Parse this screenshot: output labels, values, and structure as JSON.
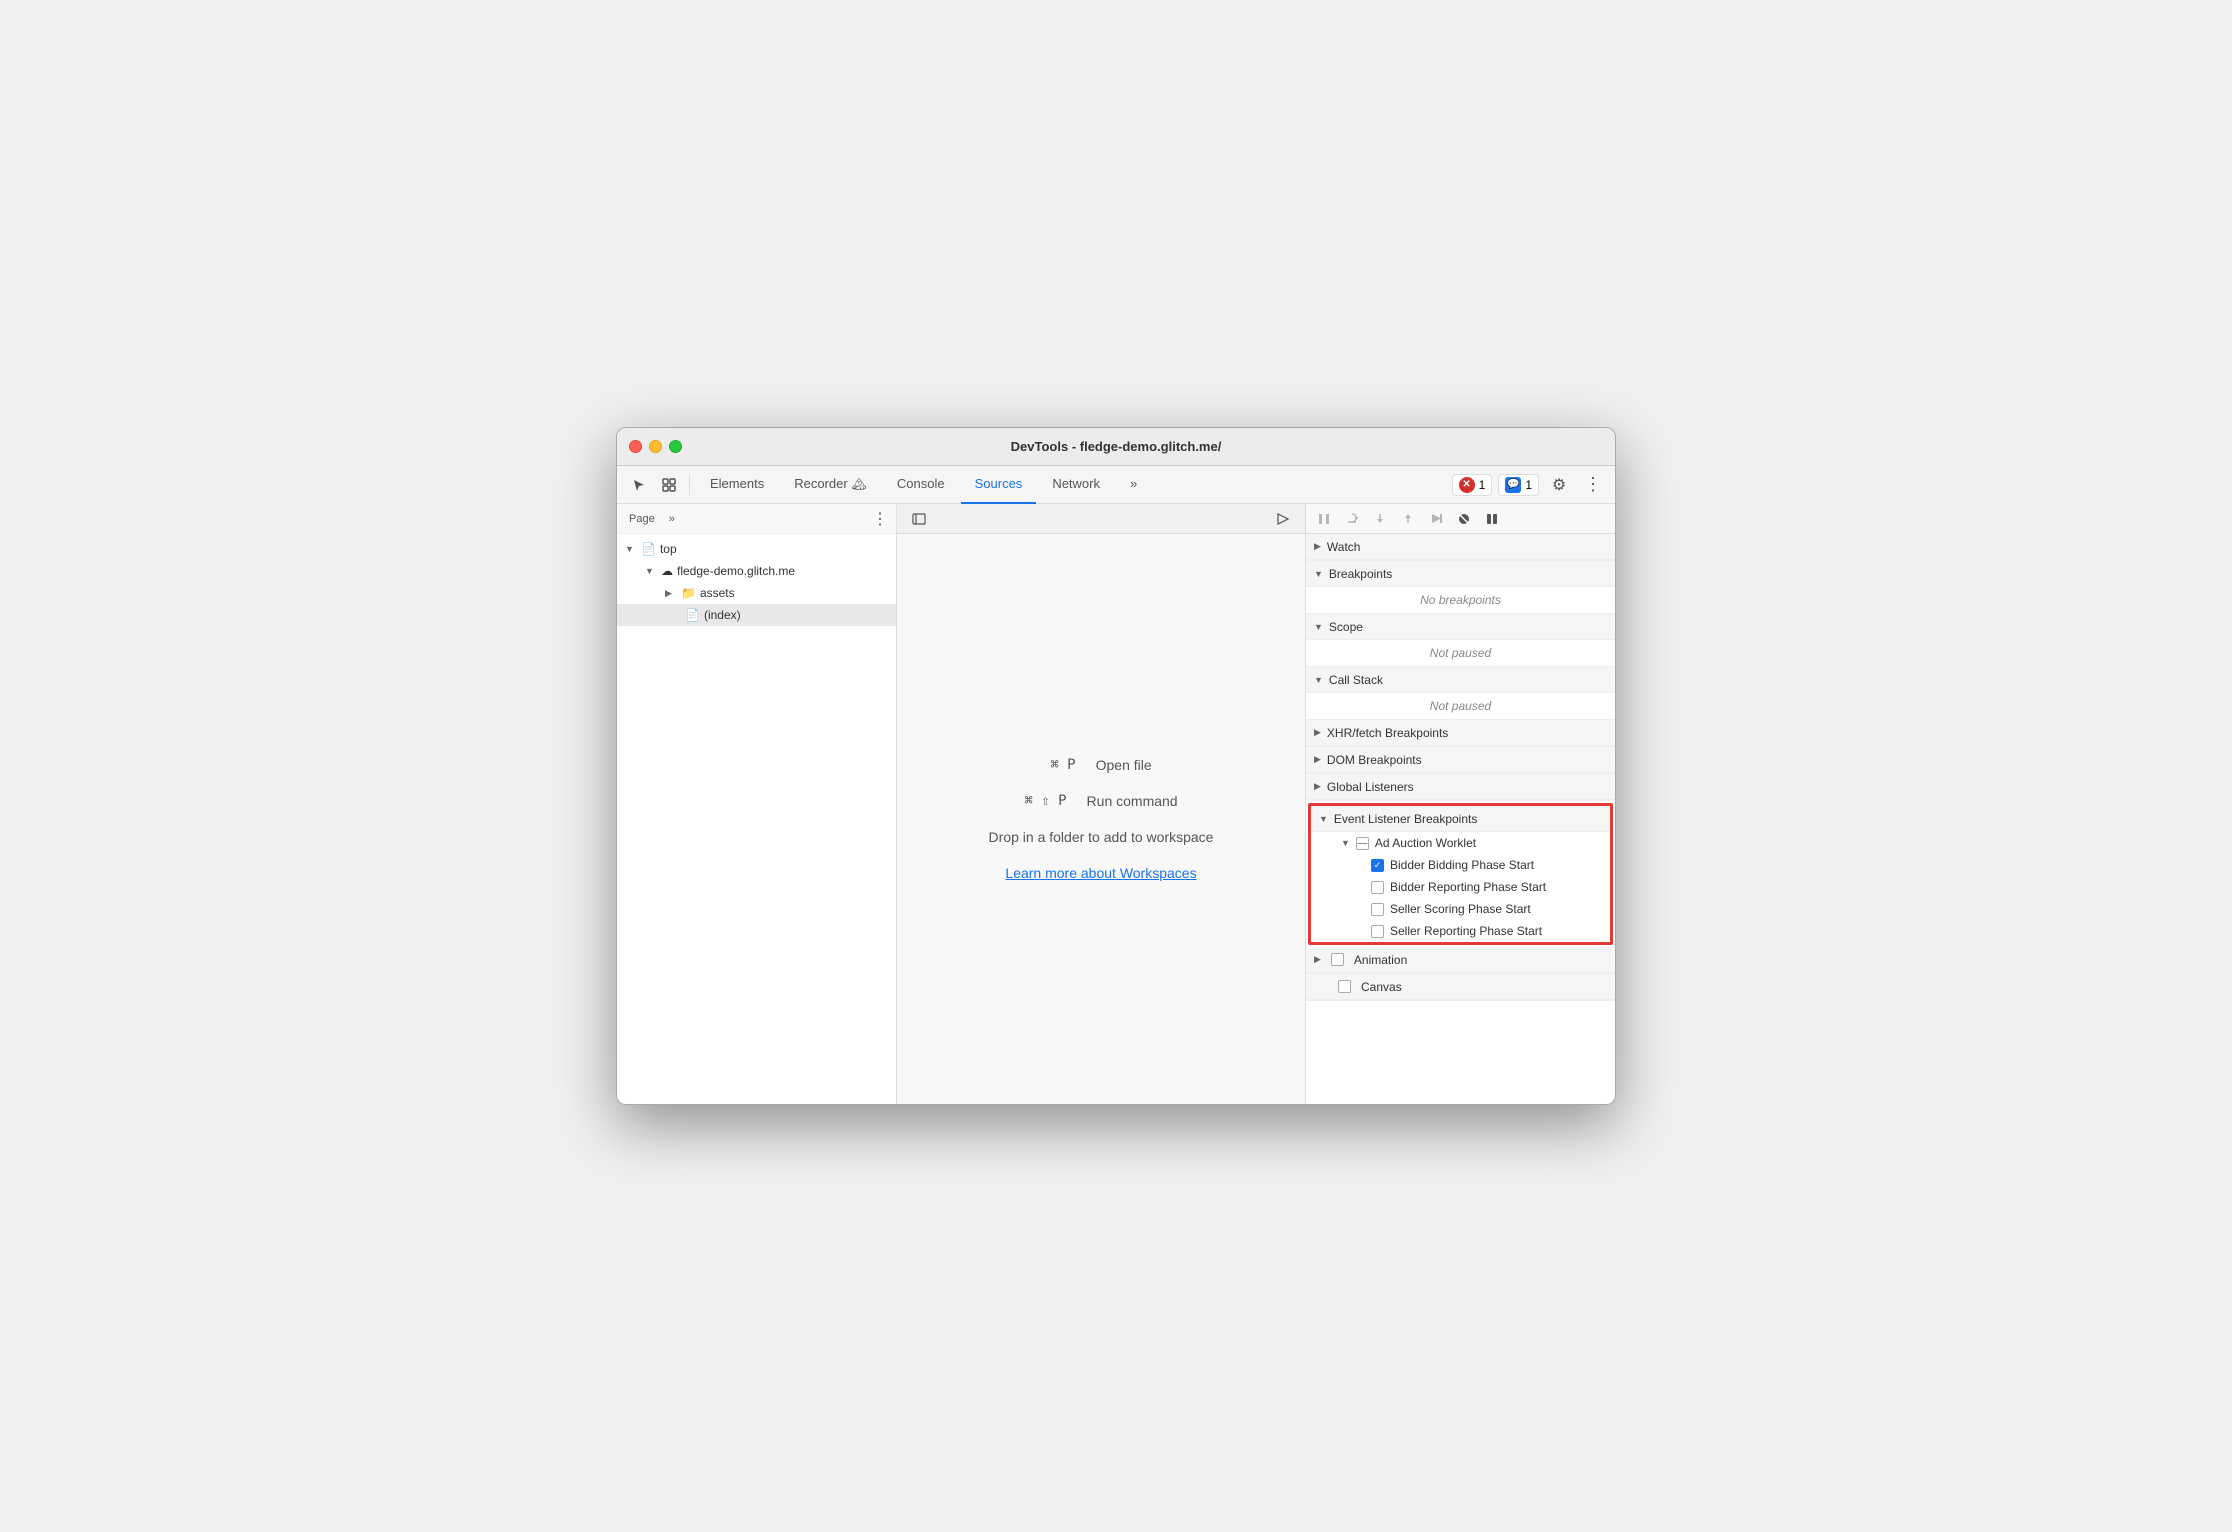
{
  "window": {
    "title": "DevTools - fledge-demo.glitch.me/"
  },
  "toolbar": {
    "tabs": [
      "Elements",
      "Recorder",
      "Console",
      "Sources",
      "Network"
    ],
    "active_tab": "Sources",
    "more_tabs": "»",
    "error_count": "1",
    "message_count": "1",
    "settings_label": "⚙",
    "more_label": "⋮"
  },
  "left_panel": {
    "page_label": "Page",
    "more_icon": "»",
    "more_options": "⋮",
    "tree": [
      {
        "label": "top",
        "type": "root",
        "expanded": true,
        "indent": 0
      },
      {
        "label": "fledge-demo.glitch.me",
        "type": "domain",
        "expanded": true,
        "indent": 1
      },
      {
        "label": "assets",
        "type": "folder",
        "expanded": false,
        "indent": 2
      },
      {
        "label": "(index)",
        "type": "file",
        "selected": true,
        "indent": 2
      }
    ]
  },
  "middle_panel": {
    "shortcut1_key": "⌘ P",
    "shortcut1_label": "Open file",
    "shortcut2_key": "⌘ ⇧ P",
    "shortcut2_label": "Run command",
    "drop_text": "Drop in a folder to add to workspace",
    "workspace_link": "Learn more about Workspaces"
  },
  "right_panel": {
    "sections": [
      {
        "id": "watch",
        "label": "Watch",
        "collapsed": true
      },
      {
        "id": "breakpoints",
        "label": "Breakpoints",
        "collapsed": false,
        "content": "No breakpoints",
        "content_italic": true
      },
      {
        "id": "scope",
        "label": "Scope",
        "collapsed": false,
        "content": "Not paused",
        "content_italic": true
      },
      {
        "id": "call_stack",
        "label": "Call Stack",
        "collapsed": false,
        "content": "Not paused",
        "content_italic": true
      },
      {
        "id": "xhr_fetch",
        "label": "XHR/fetch Breakpoints",
        "collapsed": true
      },
      {
        "id": "dom",
        "label": "DOM Breakpoints",
        "collapsed": true
      },
      {
        "id": "global_listeners",
        "label": "Global Listeners",
        "collapsed": true
      },
      {
        "id": "event_listener_breakpoints",
        "label": "Event Listener Breakpoints",
        "highlighted": true,
        "collapsed": false,
        "sub_sections": [
          {
            "label": "Ad Auction Worklet",
            "expanded": true,
            "items": [
              {
                "label": "Bidder Bidding Phase Start",
                "checked": true
              },
              {
                "label": "Bidder Reporting Phase Start",
                "checked": false
              },
              {
                "label": "Seller Scoring Phase Start",
                "checked": false
              },
              {
                "label": "Seller Reporting Phase Start",
                "checked": false
              }
            ]
          }
        ]
      },
      {
        "id": "animation",
        "label": "Animation",
        "collapsed": true
      },
      {
        "id": "canvas",
        "label": "Canvas",
        "collapsed": true
      }
    ]
  }
}
